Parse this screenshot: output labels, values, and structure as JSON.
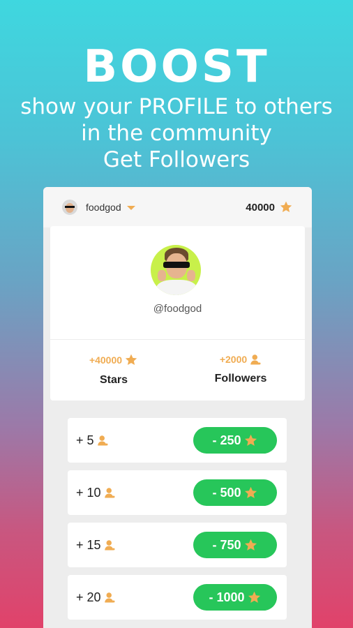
{
  "hero": {
    "title": "BOOST",
    "line1": "show your PROFILE to others",
    "line2": "in the community",
    "line3": "Get Followers"
  },
  "topbar": {
    "username": "foodgod",
    "balance": "40000"
  },
  "profile": {
    "handle": "@foodgod",
    "stats": [
      {
        "amount": "+40000",
        "label": "Stars",
        "icon": "star-icon"
      },
      {
        "amount": "+2000",
        "label": "Followers",
        "icon": "person-icon"
      }
    ]
  },
  "offers": [
    {
      "gain": "+ 5",
      "cost": "- 250"
    },
    {
      "gain": "+ 10",
      "cost": "- 500"
    },
    {
      "gain": "+ 15",
      "cost": "- 750"
    },
    {
      "gain": "+ 20",
      "cost": "- 1000"
    }
  ],
  "colors": {
    "accent_orange": "#f0ac52",
    "button_green": "#27c65a",
    "bg_top": "#3fd7df",
    "bg_bottom": "#e1426a"
  }
}
